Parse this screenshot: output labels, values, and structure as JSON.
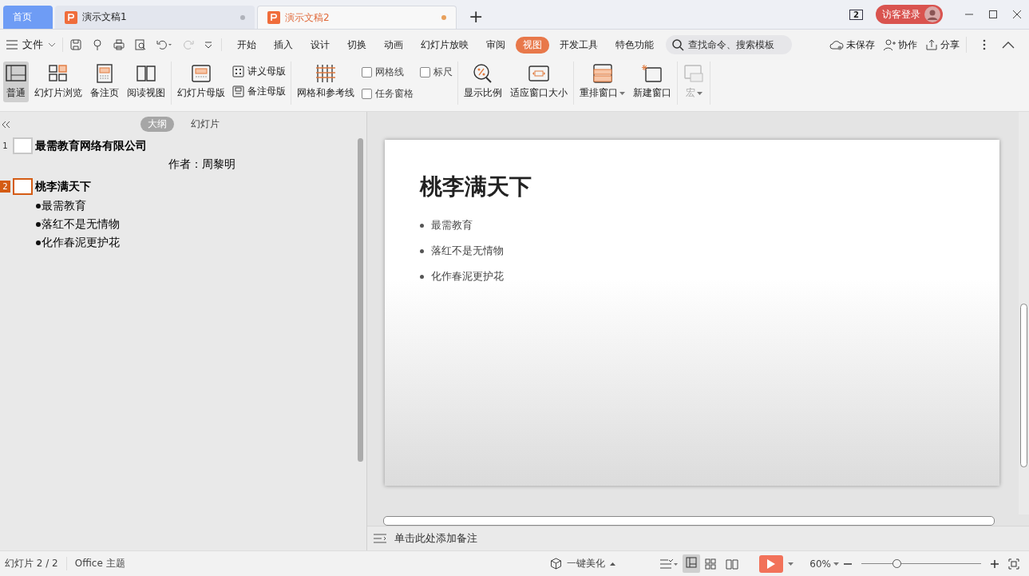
{
  "tabs": [
    {
      "label": "首页",
      "kind": "home",
      "selected": false
    },
    {
      "label": "演示文稿1",
      "kind": "doc",
      "selected": false
    },
    {
      "label": "演示文稿2",
      "kind": "doc",
      "selected": true
    }
  ],
  "new_tab": "+",
  "window_count": "2",
  "login": "访客登录",
  "menu": {
    "file": "文件",
    "ribbon_tabs": [
      {
        "label": "开始",
        "selected": false
      },
      {
        "label": "插入",
        "selected": false
      },
      {
        "label": "设计",
        "selected": false
      },
      {
        "label": "切换",
        "selected": false
      },
      {
        "label": "动画",
        "selected": false
      },
      {
        "label": "幻灯片放映",
        "selected": false
      },
      {
        "label": "审阅",
        "selected": false
      },
      {
        "label": "视图",
        "selected": true
      },
      {
        "label": "开发工具",
        "selected": false
      },
      {
        "label": "特色功能",
        "selected": false
      }
    ],
    "search": {
      "placeholder": "查找命令、搜索模板"
    },
    "actions": [
      "未保存",
      "协作",
      "分享"
    ]
  },
  "ribbon": [
    [
      {
        "kind": "large",
        "label": "普通",
        "selected": true
      },
      {
        "kind": "large",
        "label": "幻灯片浏览",
        "selected": false
      },
      {
        "kind": "large",
        "label": "备注页",
        "selected": false
      },
      {
        "kind": "large",
        "label": "阅读视图",
        "selected": false
      }
    ],
    [
      {
        "kind": "large",
        "label": "幻灯片母版",
        "selected": false
      },
      {
        "kind": "stack",
        "items": [
          "讲义母版",
          "备注母版"
        ]
      }
    ],
    [
      {
        "kind": "large",
        "label": "网格和参考线",
        "selected": false
      },
      {
        "kind": "checks",
        "items": [
          {
            "label": "网格线",
            "checked": false
          },
          {
            "label": "任务窗格",
            "checked": false
          }
        ]
      },
      {
        "kind": "checks",
        "items": [
          {
            "label": "标尺",
            "checked": false
          }
        ]
      }
    ],
    [
      {
        "kind": "large",
        "label": "显示比例",
        "selected": false
      },
      {
        "kind": "large",
        "label": "适应窗口大小",
        "selected": false
      }
    ],
    [
      {
        "kind": "large",
        "label": "重排窗口",
        "selected": false,
        "dropdown": true
      },
      {
        "kind": "large",
        "label": "新建窗口",
        "selected": false
      }
    ],
    [
      {
        "kind": "large",
        "label": "宏",
        "selected": false,
        "dropdown": true,
        "disabled": true
      }
    ]
  ],
  "outline": {
    "tabs": [
      {
        "label": "大纲",
        "selected": true
      },
      {
        "label": "幻灯片",
        "selected": false
      }
    ],
    "slides": [
      {
        "number": "1",
        "selected": false,
        "title": "最需教育网络有限公司",
        "lines": [
          {
            "kind": "subtitle",
            "text": "作者：周黎明"
          }
        ]
      },
      {
        "number": "2",
        "selected": true,
        "title": "桃李满天下",
        "lines": [
          {
            "kind": "bullet",
            "text": "最需教育"
          },
          {
            "kind": "bullet",
            "text": "落红不是无情物"
          },
          {
            "kind": "bullet",
            "text": "化作春泥更护花"
          }
        ]
      }
    ]
  },
  "slide": {
    "title": "桃李满天下",
    "bullets": [
      "最需教育",
      "落红不是无情物",
      "化作春泥更护花"
    ]
  },
  "notes": {
    "placeholder": "单击此处添加备注"
  },
  "status_bar": {
    "slide_counter": "幻灯片 2 / 2",
    "theme": "Office 主题",
    "beautify": "一键美化",
    "zoom": "60%",
    "zoom_slider": {
      "level": 0.3
    }
  }
}
